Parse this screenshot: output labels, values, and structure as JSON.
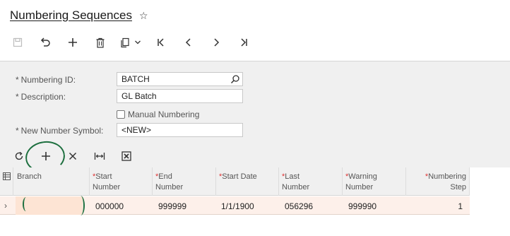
{
  "header": {
    "title": "Numbering Sequences",
    "favorite_icon": "star-icon"
  },
  "toolbar": {
    "buttons": [
      {
        "name": "save-button",
        "icon": "save-icon",
        "enabled": false
      },
      {
        "name": "undo-button",
        "icon": "undo-icon",
        "enabled": true
      },
      {
        "name": "add-button",
        "icon": "plus-icon",
        "enabled": true
      },
      {
        "name": "delete-button",
        "icon": "trash-icon",
        "enabled": true
      },
      {
        "name": "copy-paste-button",
        "icon": "clipboard-icon",
        "enabled": true
      },
      {
        "name": "first-record-button",
        "icon": "first-icon",
        "enabled": true
      },
      {
        "name": "previous-record-button",
        "icon": "previous-icon",
        "enabled": true
      },
      {
        "name": "next-record-button",
        "icon": "next-icon",
        "enabled": true
      },
      {
        "name": "last-record-button",
        "icon": "last-icon",
        "enabled": true
      }
    ]
  },
  "form": {
    "numbering_id": {
      "label": "Numbering ID:",
      "value": "BATCH"
    },
    "description": {
      "label": "Description:",
      "value": "GL Batch"
    },
    "manual_numbering": {
      "label": "Manual Numbering",
      "checked": false
    },
    "new_number_symbol": {
      "label": "New Number Symbol:",
      "value": "<NEW>"
    },
    "required_marker": "*"
  },
  "grid": {
    "toolbar": [
      "refresh-icon",
      "plus-icon",
      "close-icon",
      "fit-columns-icon",
      "excel-icon"
    ],
    "columns": [
      {
        "line1": "Branch",
        "line2": "",
        "required": false
      },
      {
        "line1": "Start",
        "line2": "Number",
        "required": true
      },
      {
        "line1": "End",
        "line2": "Number",
        "required": true
      },
      {
        "line1": "Start Date",
        "line2": "",
        "required": true
      },
      {
        "line1": "Last",
        "line2": "Number",
        "required": true
      },
      {
        "line1": "Warning",
        "line2": "Number",
        "required": true
      },
      {
        "line1": "Numbering",
        "line2": "Step",
        "required": true
      }
    ],
    "rows": [
      {
        "branch": "",
        "start_number": "000000",
        "end_number": "999999",
        "start_date": "1/1/1900",
        "last_number": "056296",
        "warning_number": "999990",
        "numbering_step": "1"
      }
    ]
  },
  "colors": {
    "annotation_green": "#1d6f3f",
    "active_row": "#fdf0ea",
    "required_star": "#dd3333"
  }
}
